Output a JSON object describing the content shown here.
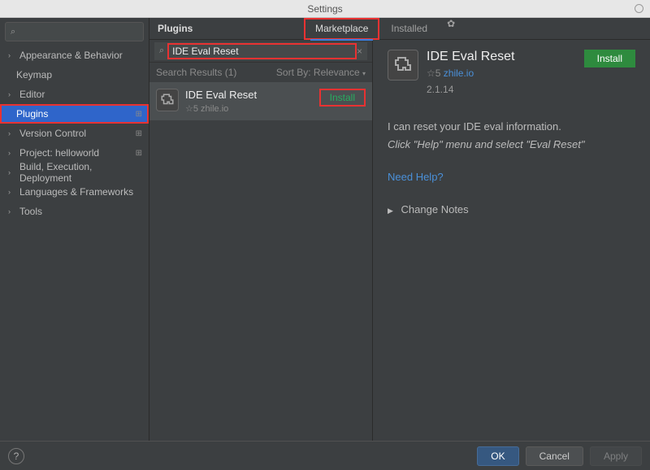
{
  "window": {
    "title": "Settings"
  },
  "sidebar": {
    "search_placeholder": "",
    "items": [
      {
        "label": "Appearance & Behavior",
        "expandable": true
      },
      {
        "label": "Keymap",
        "expandable": false
      },
      {
        "label": "Editor",
        "expandable": true
      },
      {
        "label": "Plugins",
        "expandable": false,
        "badge": true,
        "selected": true
      },
      {
        "label": "Version Control",
        "expandable": true,
        "badge": true
      },
      {
        "label": "Project: helloworld",
        "expandable": true,
        "badge": true
      },
      {
        "label": "Build, Execution, Deployment",
        "expandable": true
      },
      {
        "label": "Languages & Frameworks",
        "expandable": true
      },
      {
        "label": "Tools",
        "expandable": true
      }
    ]
  },
  "plugins": {
    "title": "Plugins",
    "tabs": {
      "marketplace": "Marketplace",
      "installed": "Installed"
    },
    "search_value": "IDE Eval Reset",
    "results_header": "Search Results (1)",
    "sort_label": "Sort By: Relevance",
    "result": {
      "name": "IDE Eval Reset",
      "source_prefix": "☆5",
      "source": "zhile.io",
      "install_label": "Install"
    },
    "detail": {
      "name": "IDE Eval Reset",
      "source_prefix": "☆5",
      "source": "zhile.io",
      "version": "2.1.14",
      "install_label": "Install",
      "desc_line1": "I can reset your IDE eval information.",
      "desc_line2": "Click \"Help\" menu and select \"Eval Reset\"",
      "help_link": "Need Help?",
      "change_notes": "Change Notes"
    }
  },
  "footer": {
    "ok": "OK",
    "cancel": "Cancel",
    "apply": "Apply"
  }
}
